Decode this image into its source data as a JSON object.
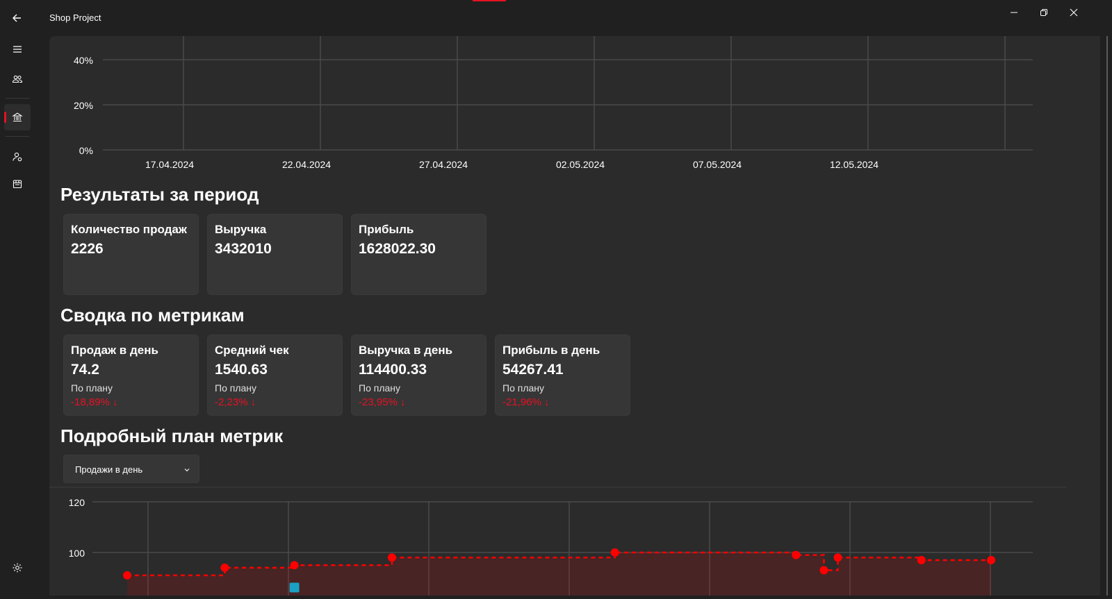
{
  "window": {
    "title": "Shop Project",
    "accent": "#e81123"
  },
  "sidebar": {
    "items": [
      {
        "icon": "menu-icon"
      },
      {
        "icon": "users-icon"
      },
      {
        "icon": "bank-icon",
        "active": true
      },
      {
        "icon": "user-settings-icon"
      },
      {
        "icon": "store-icon"
      },
      {
        "icon": "settings-icon"
      }
    ]
  },
  "top_chart": {
    "yticks": [
      "0%",
      "20%",
      "40%"
    ],
    "xticks": [
      "17.04.2024",
      "22.04.2024",
      "27.04.2024",
      "02.05.2024",
      "07.05.2024",
      "12.05.2024"
    ]
  },
  "results": {
    "title": "Результаты за период",
    "cards": [
      {
        "title": "Количество продаж",
        "value": "2226"
      },
      {
        "title": "Выручка",
        "value": "3432010"
      },
      {
        "title": "Прибыль",
        "value": "1628022.30"
      }
    ]
  },
  "metrics": {
    "title": "Сводка по метрикам",
    "cards": [
      {
        "title": "Продаж в день",
        "value": "74.2",
        "sub": "По плану",
        "delta": "-18,89% ↓"
      },
      {
        "title": "Средний чек",
        "value": "1540.63",
        "sub": "По плану",
        "delta": "-2,23% ↓"
      },
      {
        "title": "Выручка в день",
        "value": "114400.33",
        "sub": "По плану",
        "delta": "-23,95% ↓"
      },
      {
        "title": "Прибыль в день",
        "value": "54267.41",
        "sub": "По плану",
        "delta": "-21,96% ↓"
      }
    ]
  },
  "detail": {
    "title": "Подробный план метрик",
    "dropdown": {
      "selected": "Продажи в день"
    }
  },
  "chart_data": [
    {
      "type": "line",
      "title": "",
      "xlabel": "",
      "ylabel": "",
      "x_ticks": [
        "17.04.2024",
        "22.04.2024",
        "27.04.2024",
        "02.05.2024",
        "07.05.2024",
        "12.05.2024"
      ],
      "y_ticks": [
        "0%",
        "20%",
        "40%"
      ],
      "ylim": [
        0,
        40
      ],
      "grid": true,
      "series": []
    },
    {
      "type": "line",
      "title": "",
      "xlabel": "",
      "ylabel": "",
      "y_ticks": [
        "100",
        "120"
      ],
      "grid": true,
      "series": [
        {
          "color": "#ff0000",
          "style": "dashed-step",
          "points": [
            {
              "x": 0,
              "y": 91
            },
            {
              "x": 3.5,
              "y": 94
            },
            {
              "x": 6,
              "y": 95
            },
            {
              "x": 9.5,
              "y": 98
            },
            {
              "x": 17.5,
              "y": 100
            },
            {
              "x": 24,
              "y": 99
            },
            {
              "x": 25,
              "y": 93
            },
            {
              "x": 25.5,
              "y": 98
            },
            {
              "x": 28.5,
              "y": 97
            },
            {
              "x": 31,
              "y": 97
            }
          ]
        },
        {
          "color": "#1ba1c4",
          "style": "markers",
          "points": [
            {
              "x": 6,
              "y": 87
            }
          ]
        }
      ]
    }
  ]
}
